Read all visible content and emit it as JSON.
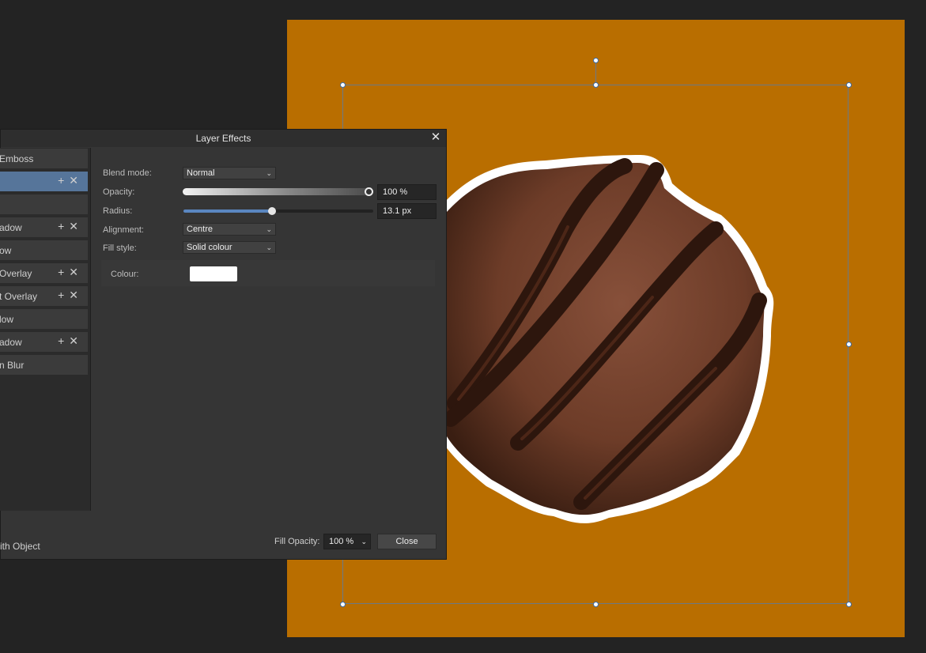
{
  "dialog": {
    "title": "Layer Effects",
    "close_glyph": "✕",
    "effects": [
      {
        "label": "Emboss",
        "has_actions": false,
        "selected": false
      },
      {
        "label": "",
        "has_actions": true,
        "selected": true
      },
      {
        "label": "",
        "has_actions": false,
        "selected": false
      },
      {
        "label": "adow",
        "has_actions": true,
        "selected": false
      },
      {
        "label": "ow",
        "has_actions": false,
        "selected": false
      },
      {
        "label": "Overlay",
        "has_actions": true,
        "selected": false
      },
      {
        "label": "t Overlay",
        "has_actions": true,
        "selected": false
      },
      {
        "label": "low",
        "has_actions": false,
        "selected": false
      },
      {
        "label": "adow",
        "has_actions": true,
        "selected": false
      },
      {
        "label": "n Blur",
        "has_actions": false,
        "selected": false
      }
    ],
    "effects_labels": {
      "e0": "Emboss",
      "e3": "adow",
      "e4": "ow",
      "e5": "Overlay",
      "e6": "t Overlay",
      "e7": "low",
      "e8": "adow",
      "e9": "n Blur"
    },
    "action_glyphs": "+ ✕",
    "settings": {
      "blend_mode_label": "Blend mode:",
      "blend_mode_value": "Normal",
      "opacity_label": "Opacity:",
      "opacity_value": "100 %",
      "opacity_level": 1.0,
      "radius_label": "Radius:",
      "radius_value": "13.1 px",
      "alignment_label": "Alignment:",
      "alignment_value": "Centre",
      "fill_style_label": "Fill style:",
      "fill_style_value": "Solid colour",
      "colour_label": "Colour:",
      "colour_value": "#ffffff"
    },
    "footer": {
      "left_text": "ith Object",
      "fill_opacity_label": "Fill Opacity:",
      "fill_opacity_value": "100 %",
      "close_button": "Close"
    }
  },
  "colors": {
    "canvas_bg": "#b96e00",
    "accent": "#56759a",
    "outline": "#ffffff"
  },
  "icons": {
    "dropdown": "chevron-down-icon",
    "add": "plus-icon",
    "remove": "x-icon"
  }
}
